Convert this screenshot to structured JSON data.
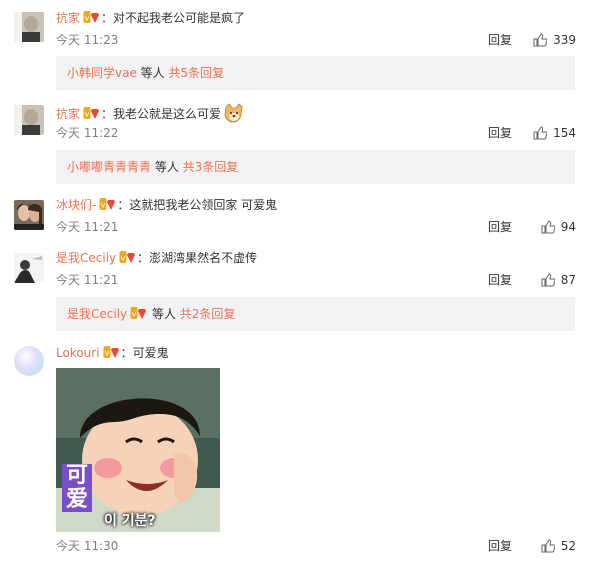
{
  "comments": [
    {
      "username": "抗家",
      "separator": "：",
      "text": "对不起我老公可能是疯了",
      "time": "今天 11:23",
      "reply_label": "回复",
      "likes": "339",
      "reply_summary": {
        "users": "小韩同学vae",
        "middle": " 等人 ",
        "count_link": "共5条回复"
      }
    },
    {
      "username": "抗家",
      "separator": "：",
      "text": "我老公就是这么可爱",
      "emoji": "doge-emoji",
      "time": "今天 11:22",
      "reply_label": "回复",
      "likes": "154",
      "reply_summary": {
        "users": "小嘟嘟青青青青",
        "middle": " 等人 ",
        "count_link": "共3条回复"
      }
    },
    {
      "username": "冰块们-",
      "separator": "：",
      "text": "这就把我老公领回家 可爱鬼",
      "time": "今天 11:21",
      "reply_label": "回复",
      "likes": "94"
    },
    {
      "username": "是我Cecily",
      "separator": "：",
      "text": "澎湖湾果然名不虚传",
      "time": "今天 11:21",
      "reply_label": "回复",
      "likes": "87",
      "reply_summary": {
        "users": "是我Cecily",
        "middle": " 等人 ",
        "count_link": "共2条回复"
      }
    },
    {
      "username": "Lokouri",
      "separator": "：",
      "text": "可爱鬼",
      "time": "今天 11:30",
      "reply_label": "回复",
      "likes": "52",
      "sticker": {
        "caption_big": "可爱",
        "caption_kr": "이 기분?"
      }
    }
  ],
  "colors": {
    "username": "#eb7350",
    "meta": "#808080",
    "reply_bar": "#f2f2f5"
  },
  "icons": {
    "like": "thumbs-up-icon",
    "badge": "vip-badge-icon"
  }
}
